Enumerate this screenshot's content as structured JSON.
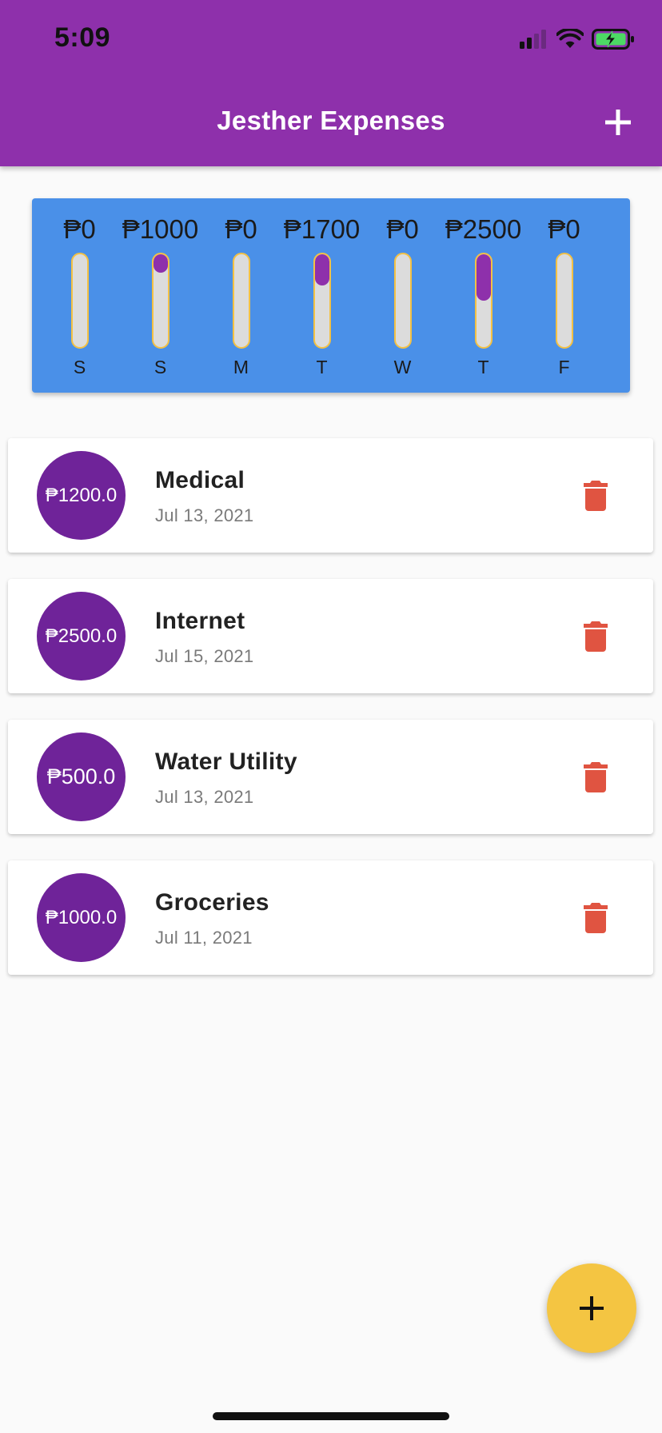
{
  "status_bar": {
    "time": "5:09",
    "icons": [
      "cellular-signal-icon",
      "wifi-icon",
      "battery-charging-icon"
    ]
  },
  "app_bar": {
    "title": "Jesther Expenses",
    "action_icon": "plus-icon"
  },
  "weekly_chart": {
    "days": [
      {
        "day": "S",
        "amount": "₱0",
        "fill_fraction": 0.0
      },
      {
        "day": "S",
        "amount": "₱1000",
        "fill_fraction": 0.2
      },
      {
        "day": "M",
        "amount": "₱0",
        "fill_fraction": 0.0
      },
      {
        "day": "T",
        "amount": "₱1700",
        "fill_fraction": 0.34
      },
      {
        "day": "W",
        "amount": "₱0",
        "fill_fraction": 0.0
      },
      {
        "day": "T",
        "amount": "₱2500",
        "fill_fraction": 0.5
      },
      {
        "day": "F",
        "amount": "₱0",
        "fill_fraction": 0.0
      }
    ]
  },
  "expenses": [
    {
      "amount": "₱1200.0",
      "title": "Medical",
      "date": "Jul 13, 2021"
    },
    {
      "amount": "₱2500.0",
      "title": "Internet",
      "date": "Jul 15, 2021"
    },
    {
      "amount": "₱500.0",
      "title": "Water Utility",
      "date": "Jul 13, 2021"
    },
    {
      "amount": "₱1000.0",
      "title": "Groceries",
      "date": "Jul 11, 2021"
    }
  ],
  "colors": {
    "app_bar": "#8e30ab",
    "chart_background": "#4a90e8",
    "chart_fill": "#8e30ab",
    "chart_bar_border": "#f3c144",
    "amount_circle": "#6f2399",
    "delete_icon": "#e05441",
    "fab": "#f4c542"
  },
  "fab": {
    "icon": "plus-icon"
  }
}
